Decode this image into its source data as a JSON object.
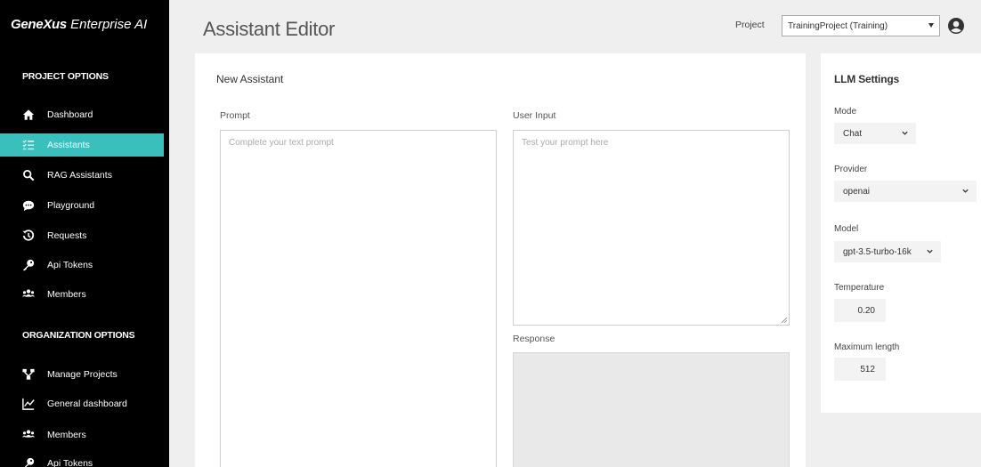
{
  "brand": {
    "name_bold": "GeneXus",
    "name_rest": " Enterprise AI"
  },
  "sidebar": {
    "project_section_title": "PROJECT OPTIONS",
    "project_items": [
      {
        "label": "Dashboard",
        "icon": "home-icon"
      },
      {
        "label": "Assistants",
        "icon": "list-check-icon"
      },
      {
        "label": "RAG Assistants",
        "icon": "search-icon"
      },
      {
        "label": "Playground",
        "icon": "chat-bubble-icon"
      },
      {
        "label": "Requests",
        "icon": "history-icon"
      },
      {
        "label": "Api Tokens",
        "icon": "key-icon"
      },
      {
        "label": "Members",
        "icon": "users-icon"
      }
    ],
    "org_section_title": "ORGANIZATION OPTIONS",
    "org_items": [
      {
        "label": "Manage Projects",
        "icon": "sitemap-icon"
      },
      {
        "label": "General dashboard",
        "icon": "line-chart-icon"
      },
      {
        "label": "Members",
        "icon": "users-icon"
      },
      {
        "label": "Api Tokens",
        "icon": "key-icon"
      }
    ],
    "active_item": "Assistants",
    "accent_color": "#3bbfbc"
  },
  "header": {
    "title": "Assistant Editor",
    "project_label": "Project",
    "project_value": "TrainingProject (Training)"
  },
  "editor": {
    "card_title": "New Assistant",
    "prompt_label": "Prompt",
    "prompt_placeholder": "Complete your text prompt",
    "user_input_label": "User Input",
    "user_input_placeholder": "Test your prompt here",
    "response_label": "Response"
  },
  "llm_settings": {
    "title": "LLM Settings",
    "mode_label": "Mode",
    "mode_value": "Chat",
    "provider_label": "Provider",
    "provider_value": "openai",
    "model_label": "Model",
    "model_value": "gpt-3.5-turbo-16k",
    "temperature_label": "Temperature",
    "temperature_value": "0.20",
    "max_length_label": "Maximum length",
    "max_length_value": "512"
  }
}
